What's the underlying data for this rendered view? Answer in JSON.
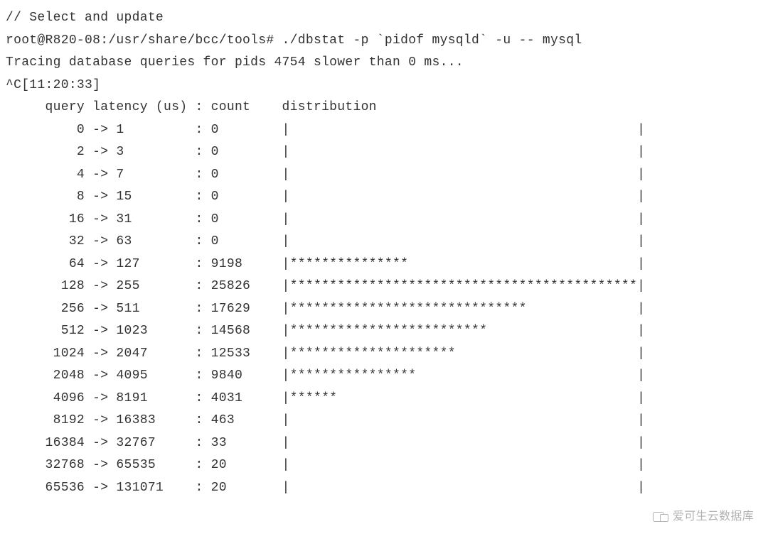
{
  "header": {
    "comment": "// Select and update",
    "prompt": "root@R820-08:/usr/share/bcc/tools# ./dbstat -p `pidof mysqld` -u -- mysql",
    "trace_line": "Tracing database queries for pids 4754 slower than 0 ms...",
    "interrupt": "^C[11:20:33]"
  },
  "columns": {
    "query_latency": "query latency (us)",
    "count": "count",
    "distribution": "distribution"
  },
  "rows": [
    {
      "from": "0",
      "to": "1",
      "count": "0",
      "bar": ""
    },
    {
      "from": "2",
      "to": "3",
      "count": "0",
      "bar": ""
    },
    {
      "from": "4",
      "to": "7",
      "count": "0",
      "bar": ""
    },
    {
      "from": "8",
      "to": "15",
      "count": "0",
      "bar": ""
    },
    {
      "from": "16",
      "to": "31",
      "count": "0",
      "bar": ""
    },
    {
      "from": "32",
      "to": "63",
      "count": "0",
      "bar": ""
    },
    {
      "from": "64",
      "to": "127",
      "count": "9198",
      "bar": "***************"
    },
    {
      "from": "128",
      "to": "255",
      "count": "25826",
      "bar": "********************************************"
    },
    {
      "from": "256",
      "to": "511",
      "count": "17629",
      "bar": "******************************"
    },
    {
      "from": "512",
      "to": "1023",
      "count": "14568",
      "bar": "*************************"
    },
    {
      "from": "1024",
      "to": "2047",
      "count": "12533",
      "bar": "*********************"
    },
    {
      "from": "2048",
      "to": "4095",
      "count": "9840",
      "bar": "****************"
    },
    {
      "from": "4096",
      "to": "8191",
      "count": "4031",
      "bar": "******"
    },
    {
      "from": "8192",
      "to": "16383",
      "count": "463",
      "bar": ""
    },
    {
      "from": "16384",
      "to": "32767",
      "count": "33",
      "bar": ""
    },
    {
      "from": "32768",
      "to": "65535",
      "count": "20",
      "bar": ""
    },
    {
      "from": "65536",
      "to": "131071",
      "count": "20",
      "bar": ""
    }
  ],
  "chart_data": {
    "type": "bar",
    "title": "query latency (us) distribution",
    "xlabel": "query latency (us)",
    "ylabel": "count",
    "categories": [
      "0-1",
      "2-3",
      "4-7",
      "8-15",
      "16-31",
      "32-63",
      "64-127",
      "128-255",
      "256-511",
      "512-1023",
      "1024-2047",
      "2048-4095",
      "4096-8191",
      "8192-16383",
      "16384-32767",
      "32768-65535",
      "65536-131071"
    ],
    "values": [
      0,
      0,
      0,
      0,
      0,
      0,
      9198,
      25826,
      17629,
      14568,
      12533,
      9840,
      4031,
      463,
      33,
      20,
      20
    ]
  },
  "watermark": {
    "text": "爱可生云数据库"
  }
}
